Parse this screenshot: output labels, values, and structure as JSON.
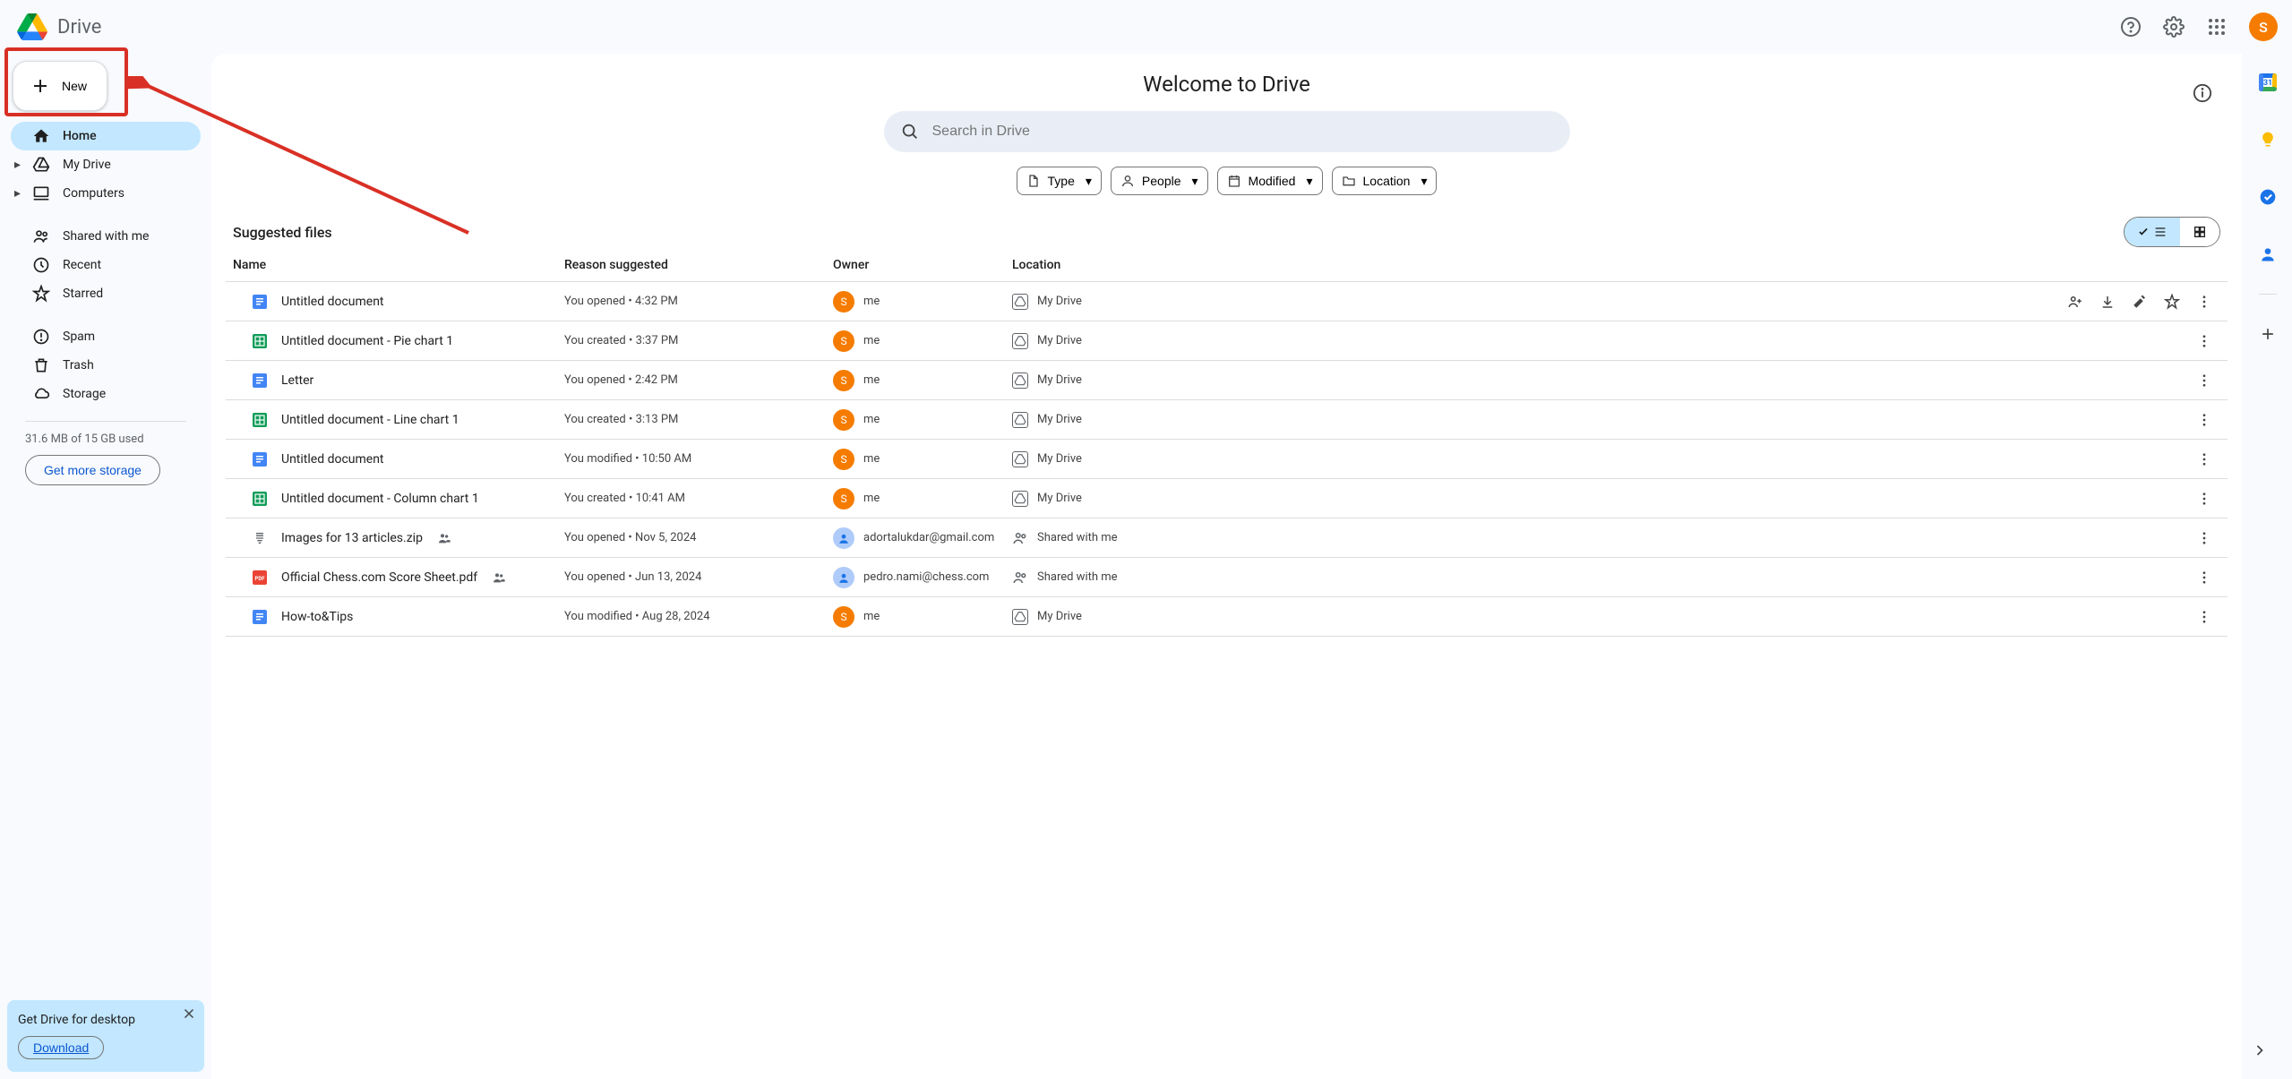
{
  "header": {
    "app_name": "Drive",
    "avatar_initial": "S"
  },
  "sidebar": {
    "new_label": "New",
    "items": [
      {
        "label": "Home"
      },
      {
        "label": "My Drive"
      },
      {
        "label": "Computers"
      },
      {
        "label": "Shared with me"
      },
      {
        "label": "Recent"
      },
      {
        "label": "Starred"
      },
      {
        "label": "Spam"
      },
      {
        "label": "Trash"
      },
      {
        "label": "Storage"
      }
    ],
    "storage_used": "31.6 MB of 15 GB used",
    "storage_cta": "Get more storage"
  },
  "desktop_banner": {
    "title": "Get Drive for desktop",
    "cta": "Download"
  },
  "main": {
    "welcome": "Welcome to Drive",
    "search_placeholder": "Search in Drive",
    "chips": {
      "type": "Type",
      "people": "People",
      "modified": "Modified",
      "location": "Location"
    },
    "section_title": "Suggested files",
    "columns": {
      "name": "Name",
      "reason": "Reason suggested",
      "owner": "Owner",
      "location": "Location"
    },
    "files": [
      {
        "type": "doc",
        "name": "Untitled document",
        "reason": "You opened • 4:32 PM",
        "owner": "me",
        "owner_initial": "S",
        "owner_color": "orange",
        "location": "My Drive",
        "loc_type": "drive",
        "hover": true
      },
      {
        "type": "sheet",
        "name": "Untitled document - Pie chart 1",
        "reason": "You created • 3:37 PM",
        "owner": "me",
        "owner_initial": "S",
        "owner_color": "orange",
        "location": "My Drive",
        "loc_type": "drive"
      },
      {
        "type": "doc",
        "name": "Letter",
        "reason": "You opened • 2:42 PM",
        "owner": "me",
        "owner_initial": "S",
        "owner_color": "orange",
        "location": "My Drive",
        "loc_type": "drive"
      },
      {
        "type": "sheet",
        "name": "Untitled document - Line chart 1",
        "reason": "You created • 3:13 PM",
        "owner": "me",
        "owner_initial": "S",
        "owner_color": "orange",
        "location": "My Drive",
        "loc_type": "drive"
      },
      {
        "type": "doc",
        "name": "Untitled document",
        "reason": "You modified • 10:50 AM",
        "owner": "me",
        "owner_initial": "S",
        "owner_color": "orange",
        "location": "My Drive",
        "loc_type": "drive"
      },
      {
        "type": "sheet",
        "name": "Untitled document - Column chart 1",
        "reason": "You created • 10:41 AM",
        "owner": "me",
        "owner_initial": "S",
        "owner_color": "orange",
        "location": "My Drive",
        "loc_type": "drive"
      },
      {
        "type": "zip",
        "name": "Images for 13 articles.zip",
        "shared": true,
        "reason": "You opened • Nov 5, 2024",
        "owner": "adortalukdar@gmail.com",
        "owner_initial": "",
        "owner_color": "blue",
        "location": "Shared with me",
        "loc_type": "shared"
      },
      {
        "type": "pdf",
        "name": "Official Chess.com Score Sheet.pdf",
        "shared": true,
        "reason": "You opened • Jun 13, 2024",
        "owner": "pedro.nami@chess.com",
        "owner_initial": "",
        "owner_color": "blue",
        "location": "Shared with me",
        "loc_type": "shared"
      },
      {
        "type": "doc",
        "name": "How-to&Tips",
        "reason": "You modified • Aug 28, 2024",
        "owner": "me",
        "owner_initial": "S",
        "owner_color": "orange",
        "location": "My Drive",
        "loc_type": "drive"
      }
    ]
  }
}
